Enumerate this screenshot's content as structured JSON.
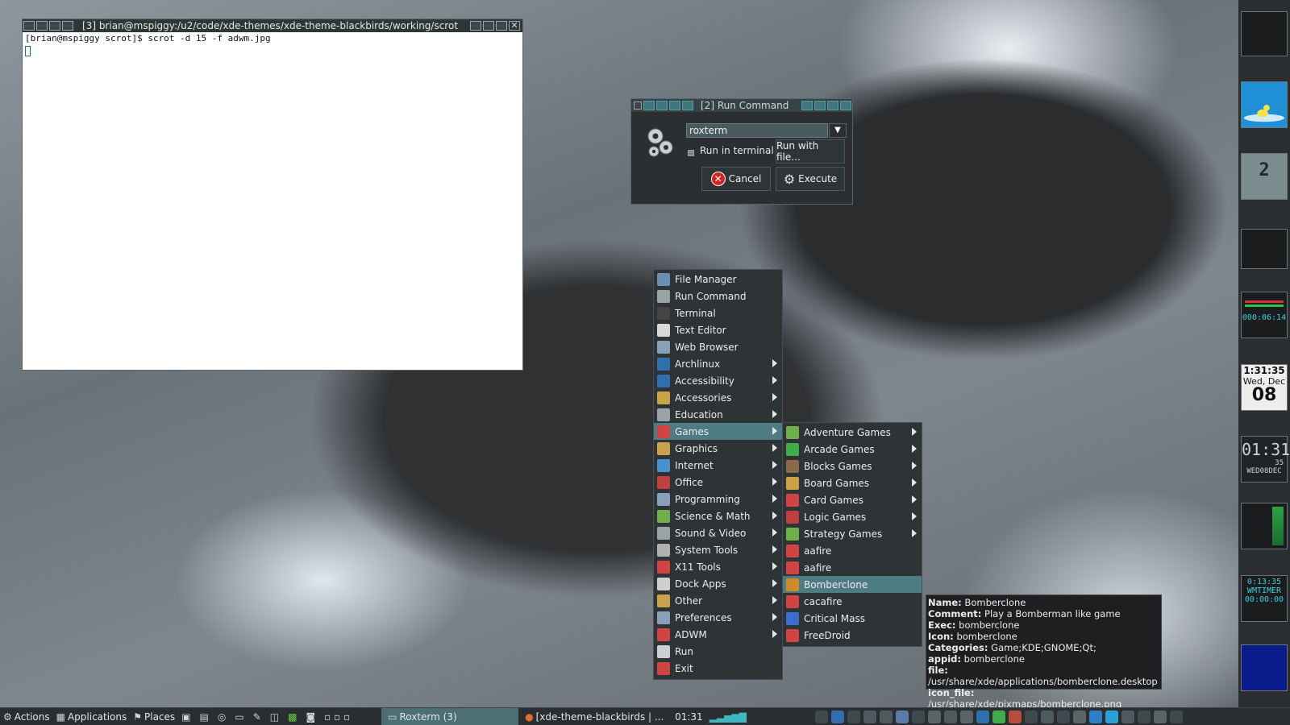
{
  "terminal": {
    "title": "[3] brian@mspiggy:/u2/code/xde-themes/xde-theme-blackbirds/working/scrot",
    "line": "[brian@mspiggy scrot]$ scrot -d 15 -f adwm.jpg"
  },
  "run_dialog": {
    "title": "[2] Run Command",
    "command_value": "roxterm",
    "run_in_terminal_label": "Run in terminal",
    "run_with_file_label": "Run with file...",
    "cancel_label": "Cancel",
    "execute_label": "Execute"
  },
  "main_menu": {
    "items": [
      {
        "label": "File Manager",
        "icon": "file-manager-icon",
        "submenu": false
      },
      {
        "label": "Run Command",
        "icon": "run-command-icon",
        "submenu": false
      },
      {
        "label": "Terminal",
        "icon": "terminal-icon",
        "submenu": false
      },
      {
        "label": "Text Editor",
        "icon": "text-editor-icon",
        "submenu": false
      },
      {
        "label": "Web Browser",
        "icon": "web-browser-icon",
        "submenu": false
      },
      {
        "label": "Archlinux",
        "icon": "archlinux-icon",
        "submenu": true
      },
      {
        "label": "Accessibility",
        "icon": "accessibility-icon",
        "submenu": true
      },
      {
        "label": "Accessories",
        "icon": "accessories-icon",
        "submenu": true
      },
      {
        "label": "Education",
        "icon": "education-icon",
        "submenu": true
      },
      {
        "label": "Games",
        "icon": "games-icon",
        "submenu": true
      },
      {
        "label": "Graphics",
        "icon": "graphics-icon",
        "submenu": true
      },
      {
        "label": "Internet",
        "icon": "internet-icon",
        "submenu": true
      },
      {
        "label": "Office",
        "icon": "office-icon",
        "submenu": true
      },
      {
        "label": "Programming",
        "icon": "programming-icon",
        "submenu": true
      },
      {
        "label": "Science & Math",
        "icon": "science-math-icon",
        "submenu": true
      },
      {
        "label": "Sound & Video",
        "icon": "sound-video-icon",
        "submenu": true
      },
      {
        "label": "System Tools",
        "icon": "system-tools-icon",
        "submenu": true
      },
      {
        "label": "X11 Tools",
        "icon": "x11-tools-icon",
        "submenu": true
      },
      {
        "label": "Dock Apps",
        "icon": "dock-apps-icon",
        "submenu": true
      },
      {
        "label": "Other",
        "icon": "other-icon",
        "submenu": true
      },
      {
        "label": "Preferences",
        "icon": "preferences-icon",
        "submenu": true
      },
      {
        "label": "ADWM",
        "icon": "adwm-icon",
        "submenu": true
      },
      {
        "label": "Run",
        "icon": "run-icon",
        "submenu": false
      },
      {
        "label": "Exit",
        "icon": "exit-icon",
        "submenu": false
      }
    ],
    "selected": "Games"
  },
  "games_menu": {
    "items": [
      {
        "label": "Adventure Games",
        "icon": "adventure-games-icon",
        "submenu": true
      },
      {
        "label": "Arcade Games",
        "icon": "arcade-games-icon",
        "submenu": true
      },
      {
        "label": "Blocks Games",
        "icon": "blocks-games-icon",
        "submenu": true
      },
      {
        "label": "Board Games",
        "icon": "board-games-icon",
        "submenu": true
      },
      {
        "label": "Card Games",
        "icon": "card-games-icon",
        "submenu": true
      },
      {
        "label": "Logic Games",
        "icon": "logic-games-icon",
        "submenu": true
      },
      {
        "label": "Strategy Games",
        "icon": "strategy-games-icon",
        "submenu": true
      },
      {
        "label": "aafire",
        "icon": "aafire-icon",
        "submenu": false
      },
      {
        "label": "aafire",
        "icon": "aafire-icon",
        "submenu": false
      },
      {
        "label": "Bomberclone",
        "icon": "bomberclone-icon",
        "submenu": false
      },
      {
        "label": "cacafire",
        "icon": "cacafire-icon",
        "submenu": false
      },
      {
        "label": "Critical Mass",
        "icon": "critical-mass-icon",
        "submenu": false
      },
      {
        "label": "FreeDroid",
        "icon": "freedroid-icon",
        "submenu": false
      }
    ],
    "selected": "Bomberclone"
  },
  "tooltip": {
    "rows": [
      {
        "key": "Name:",
        "value": " Bomberclone"
      },
      {
        "key": "Comment:",
        "value": " Play a Bomberman like game"
      },
      {
        "key": "Exec:",
        "value": " bomberclone"
      },
      {
        "key": "Icon:",
        "value": " bomberclone"
      },
      {
        "key": "Categories:",
        "value": " Game;KDE;GNOME;Qt;"
      },
      {
        "key": "appid:",
        "value": " bomberclone"
      },
      {
        "key": "file:",
        "value": " /usr/share/xde/applications/bomberclone.desktop"
      },
      {
        "key": "icon_file:",
        "value": " /usr/share/xde/pixmaps/bomberclone.png"
      }
    ]
  },
  "dock": {
    "cpu_percent": "2",
    "uptime": "000:06:14",
    "clock_time": "1:31:35",
    "clock_day": "Wed, Dec",
    "clock_date": "08",
    "digital_time": "01:31",
    "digital_sec": "35",
    "digital_date": "WED08DEC",
    "timer_time": "0:13:35",
    "timer_label": "WMTIMER",
    "timer_value": "00:00:00"
  },
  "taskbar": {
    "actions_label": "Actions",
    "applications_label": "Applications",
    "places_label": "Places",
    "active_task": "Roxterm (3)",
    "inactive_task": "[xde-theme-blackbirds | ...",
    "clock": "01:31"
  },
  "colors": {
    "selection": "#4f7b83",
    "menu_bg": "#2e3335",
    "accent_teal": "#40777f"
  }
}
